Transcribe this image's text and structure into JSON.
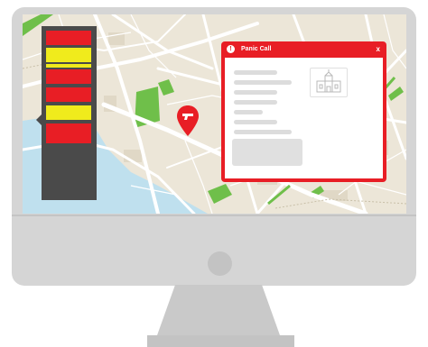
{
  "colors": {
    "map_bg": "#ece6d8",
    "water": "#bfe0ee",
    "park": "#6fbf4a",
    "alert_red": "#e81e25",
    "status_yellow": "#f0eb1c",
    "status_dark": "#4a4a4a"
  },
  "status_panel": {
    "cells": [
      "red",
      "yellow",
      "red",
      "yellow",
      "red",
      "empty"
    ]
  },
  "popup": {
    "title": "Panic Call",
    "close_label": "x",
    "alert_icon": "alert-icon",
    "thumbnail_icon": "building-icon"
  },
  "map": {
    "marker_icon": "gun-marker-icon"
  }
}
